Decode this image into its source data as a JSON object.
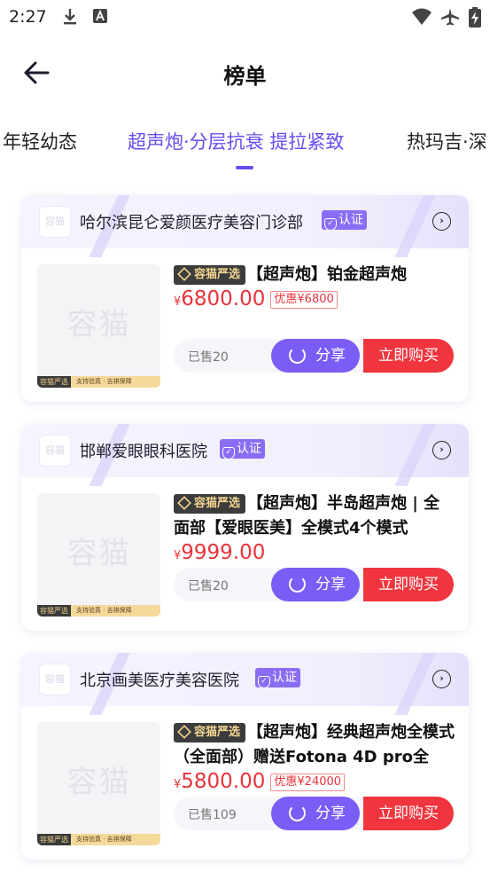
{
  "status_bar": {
    "time": "2:27"
  },
  "header": {
    "title": "榜单"
  },
  "tabs": [
    {
      "label": "年轻幼态"
    },
    {
      "label": "超声炮·分层抗衰 提拉紧致"
    },
    {
      "label": "热玛吉·深"
    }
  ],
  "cards": [
    {
      "clinic": "哈尔滨昆仑爱颜医疗美容门诊部",
      "verify": "认证",
      "logo_text": "容猫",
      "thumb_watermark": "容猫",
      "thumb_strip_label": "容猫严选",
      "thumb_strip_text": "支持验真 · 吉祺保障",
      "tag": "容猫严选",
      "title": "【超声炮】铂金超声炮",
      "currency": "¥",
      "price": "6800.00",
      "discount": "优惠¥6800",
      "sold": "已售20",
      "share": "分享",
      "buy": "立即购买"
    },
    {
      "clinic": "邯郸爱眼眼科医院",
      "verify": "认证",
      "logo_text": "容猫",
      "thumb_watermark": "容猫",
      "thumb_strip_label": "容猫严选",
      "thumb_strip_text": "支持验真 · 吉祺保障",
      "tag": "容猫严选",
      "title": "【超声炮】半岛超声炮 | 全面部【爱眼医美】全模式4个模式",
      "currency": "¥",
      "price": "9999.00",
      "discount": "",
      "sold": "已售20",
      "share": "分享",
      "buy": "立即购买"
    },
    {
      "clinic": "北京画美医疗美容医院",
      "verify": "认证",
      "logo_text": "容猫",
      "thumb_watermark": "容猫",
      "thumb_strip_label": "容猫严选",
      "thumb_strip_text": "支持验真 · 吉祺保障",
      "tag": "容猫严选",
      "title": "【超声炮】经典超声炮全模式（全面部）赠送Fotona 4D pro全",
      "currency": "¥",
      "price": "5800.00",
      "discount": "优惠¥24000",
      "sold": "已售109",
      "share": "分享",
      "buy": "立即购买"
    }
  ],
  "colors": {
    "accent": "#6a4cf0",
    "share_button": "#7b5cf5",
    "buy_button": "#f0353e",
    "price": "#e8343b",
    "tag_bg": "#3c3c3c",
    "tag_text": "#f3d591"
  }
}
